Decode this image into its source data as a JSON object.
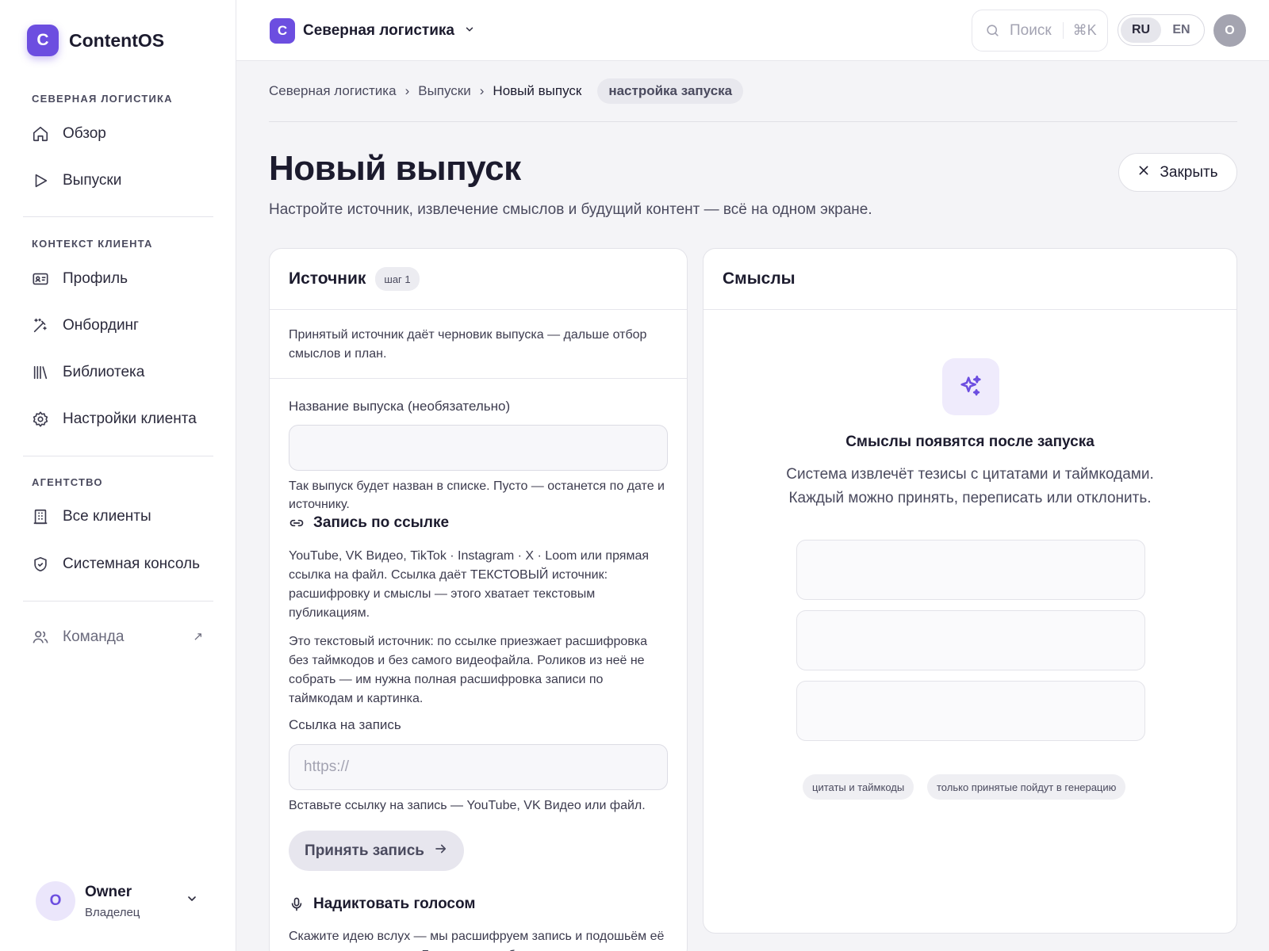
{
  "brand": {
    "logo_letter": "C",
    "name": "ContentOS",
    "accent": "#6c4ee0"
  },
  "sidebar": {
    "sections": [
      {
        "title": "СЕВЕРНАЯ ЛОГИСТИКА",
        "items": [
          {
            "label": "Обзор",
            "icon": "home-icon"
          },
          {
            "label": "Выпуски",
            "icon": "play-icon"
          }
        ]
      },
      {
        "title": "КОНТЕКСТ КЛИЕНТА",
        "items": [
          {
            "label": "Профиль",
            "icon": "id-card-icon"
          },
          {
            "label": "Онбординг",
            "icon": "magic-wand-icon"
          },
          {
            "label": "Библиотека",
            "icon": "library-icon"
          },
          {
            "label": "Настройки клиента",
            "icon": "gear-icon"
          }
        ]
      },
      {
        "title": "АГЕНТСТВО",
        "items": [
          {
            "label": "Все клиенты",
            "icon": "building-icon"
          },
          {
            "label": "Системная консоль",
            "icon": "shield-icon"
          }
        ]
      }
    ],
    "team": {
      "label": "Команда",
      "icon": "users-icon",
      "ext_icon": "external-arrow-icon"
    },
    "user": {
      "initial": "O",
      "name": "Owner",
      "role": "Владелец"
    }
  },
  "topbar": {
    "workspace": {
      "logo_letter": "C",
      "name": "Северная логистика"
    },
    "search": {
      "placeholder": "Поиск",
      "shortcut": "⌘K"
    },
    "languages": [
      "RU",
      "EN"
    ],
    "active_language": "RU",
    "avatar_initial": "O"
  },
  "breadcrumbs": {
    "items": [
      "Северная логистика",
      "Выпуски",
      "Новый выпуск"
    ],
    "badge": "настройка запуска"
  },
  "page": {
    "title": "Новый выпуск",
    "subtitle": "Настройте источник, извлечение смыслов и будущий контент — всё на одном экране.",
    "close_label": "Закрыть"
  },
  "source_card": {
    "title": "Источник",
    "step": "шаг 1",
    "intro": "Принятый источник даёт черновик выпуска — дальше отбор смыслов и план.",
    "name_label": "Название выпуска (необязательно)",
    "name_value": "",
    "name_hint": "Так выпуск будет назван в списке. Пусто — останется по дате и источнику.",
    "link_section": {
      "title": "Запись по ссылке",
      "desc1": "YouTube, VK Видео, TikTok · Instagram · X · Loom или прямая ссылка на файл. Ссылка даёт ТЕКСТОВЫЙ источник: расшифровку и смыслы — этого хватает текстовым публикациям.",
      "desc2": "Это текстовый источник: по ссылке приезжает расшифровка без таймкодов и без самого видеофайла. Роликов из неё не собрать — им нужна полная расшифровка записи по таймкодам и картинка.",
      "url_label": "Ссылка на запись",
      "url_placeholder": "https://",
      "url_hint": "Вставьте ссылку на запись — YouTube, VK Видео или файл.",
      "accept_label": "Принять запись"
    },
    "voice_section": {
      "title": "Надиктовать голосом",
      "desc": "Скажите идею вслух — мы расшифруем запись и подошьём её как источник выпуска. Говорите хотя бы полминуты — на"
    }
  },
  "meanings_card": {
    "title": "Смыслы",
    "empty_title": "Смыслы появятся после запуска",
    "empty_desc_line1": "Система извлечёт тезисы с цитатами и таймкодами.",
    "empty_desc_line2": "Каждый можно принять, переписать или отклонить.",
    "chips": [
      "цитаты и таймкоды",
      "только принятые пойдут в генерацию"
    ]
  }
}
